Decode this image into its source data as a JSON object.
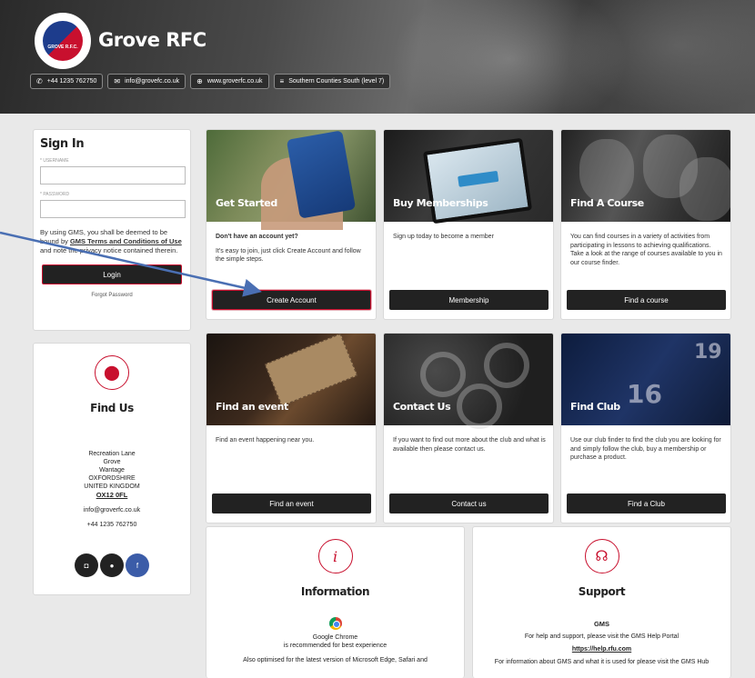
{
  "header": {
    "club_name": "Grove RFC",
    "logo_text": "GROVE R.F.C.",
    "contacts": [
      {
        "icon": "phone-icon",
        "glyph": "✆",
        "text": "+44 1235 762750"
      },
      {
        "icon": "email-icon",
        "glyph": "✉",
        "text": "info@grovefc.co.uk"
      },
      {
        "icon": "globe-icon",
        "glyph": "⊕",
        "text": "www.groverfc.co.uk"
      },
      {
        "icon": "league-icon",
        "glyph": "≡",
        "text": "Southern Counties South (level 7)"
      }
    ]
  },
  "signin": {
    "title": "Sign In",
    "username_label": "USERNAME",
    "password_label": "PASSWORD",
    "terms_prefix": "By using GMS, you shall be deemed to be bound by ",
    "terms_link": "GMS Terms and Conditions of Use",
    "terms_suffix": " and note the privacy notice contained therein.",
    "login_label": "Login",
    "forgot_label": "Forgot Password"
  },
  "findus": {
    "title": "Find Us",
    "address": [
      "Recreation Lane",
      "Grove",
      "Wantage",
      "OXFORDSHIRE",
      "UNITED KINGDOM"
    ],
    "postcode": "OX12 0FL",
    "email": "info@groverfc.co.uk",
    "phone": "+44 1235 762750",
    "socials": [
      "instagram-icon",
      "twitter-icon",
      "facebook-icon"
    ]
  },
  "tiles": [
    {
      "title": "Get Started",
      "heading": "Don't have an account yet?",
      "text": "It's easy to join, just click Create Account and follow the simple steps.",
      "button": "Create Account"
    },
    {
      "title": "Buy Memberships",
      "heading": "",
      "text": "Sign up today to become a member",
      "button": "Membership"
    },
    {
      "title": "Find A Course",
      "heading": "",
      "text": "You can find courses in a variety of activities from participating in lessons to achieving qualifications. Take a look at the range of courses available to you in our course finder.",
      "button": "Find a course"
    },
    {
      "title": "Find an event",
      "heading": "",
      "text": "Find an event happening near you.",
      "button": "Find an event"
    },
    {
      "title": "Contact Us",
      "heading": "",
      "text": "If you want to find out more about the club and what is available then please contact us.",
      "button": "Contact us"
    },
    {
      "title": "Find Club",
      "heading": "",
      "text": "Use our club finder to find the club you are looking for and simply follow the club, buy a membership or purchase a product.",
      "button": "Find a Club"
    }
  ],
  "info": {
    "title": "Information",
    "browser": "Google Chrome",
    "recommended": "is recommended for best experience",
    "also": "Also optimised for the latest version of Microsoft Edge, Safari and"
  },
  "support": {
    "title": "Support",
    "gms": "GMS",
    "help_text": "For help and support, please visit the GMS Help Portal",
    "help_link": "https://help.rfu.com",
    "hub_text": "For information about GMS and what it is used for please visit the GMS Hub"
  },
  "colors": {
    "accent": "#c8102e",
    "dark": "#222222",
    "facebook": "#3b5ca8"
  }
}
